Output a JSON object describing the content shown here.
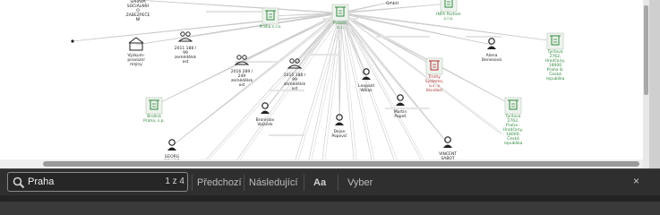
{
  "graph": {
    "nodes": [
      {
        "name": "node-sprava",
        "label": "SPRÁVA\nSOCIÁLNÍH\nO\nZABEZPEČE\nNÍ",
        "type": "text",
        "color": "#222222"
      },
      {
        "name": "node-dot",
        "label": "",
        "type": "dot",
        "color": "#222222"
      },
      {
        "name": "node-vyskum",
        "label": "Výzkum-\nprovozní\nmlýny",
        "type": "building",
        "color": "#222222"
      },
      {
        "name": "node-2011",
        "label": "2011 188 /\n99\nzemědělsk\nost",
        "type": "group",
        "color": "#222222"
      },
      {
        "name": "node-praha-green",
        "label": "Praha s.r.o.",
        "type": "doc",
        "color": "#2f8a3c"
      },
      {
        "name": "node-probitt",
        "label": "Probitt,\na.s.",
        "type": "doc",
        "color": "#2f8a3c"
      },
      {
        "name": "node-gmbh",
        "label": "GmbH",
        "type": "text",
        "color": "#222222"
      },
      {
        "name": "node-infa",
        "label": "INFA Partner\ns.r.o.",
        "type": "doc",
        "color": "#2f8a3c"
      },
      {
        "name": "node-alena",
        "label": "Alena\nBenesová",
        "type": "person",
        "color": "#222222"
      },
      {
        "name": "node-tyrsova-1",
        "label": "Tyršova\n2762,\nHradčany,\n18000\nPraha 8,\nČeská\nrepublika",
        "type": "doc",
        "color": "#2f8a3c"
      },
      {
        "name": "node-2016",
        "label": "2016 289 /\n249\nzemědělsk\nost",
        "type": "group",
        "color": "#222222"
      },
      {
        "name": "node-2015",
        "label": "2015 188 /\n99\nzemědělsk\nost",
        "type": "group",
        "color": "#222222"
      },
      {
        "name": "node-leopold",
        "label": "Leopold\nWölas",
        "type": "person",
        "color": "#222222"
      },
      {
        "name": "node-trinity",
        "label": "Trinity\nSystems,\na.s. v\nlikvidaci",
        "type": "doc",
        "color": "#b03030"
      },
      {
        "name": "node-martin",
        "label": "Martin\nPapeš",
        "type": "person",
        "color": "#222222"
      },
      {
        "name": "node-tyrsova-2",
        "label": "Tyršova\n2762,\nPraha -\nHradčany,\n18000,\nČeská\nrepublika",
        "type": "doc",
        "color": "#2f8a3c"
      },
      {
        "name": "node-brozna",
        "label": "Brožná\nPraha, s.p.",
        "type": "doc",
        "color": "#2f8a3c"
      },
      {
        "name": "node-bronislav",
        "label": "Bronislav\nVojáček",
        "type": "person",
        "color": "#222222"
      },
      {
        "name": "node-dejan",
        "label": "Dejan\nPopović",
        "type": "person",
        "color": "#222222"
      },
      {
        "name": "node-georg",
        "label": "GEORG\nSCHMID",
        "type": "person",
        "color": "#222222"
      },
      {
        "name": "node-vincent",
        "label": "VINCENT\nSABOT",
        "type": "person",
        "color": "#222222"
      }
    ]
  },
  "findbar": {
    "search_value": "Praha",
    "match_count": "1 z 4",
    "prev_label": "Předchozí",
    "next_label": "Následující",
    "case_label": "Aa",
    "select_label": "Vyber",
    "close_label": "×"
  }
}
